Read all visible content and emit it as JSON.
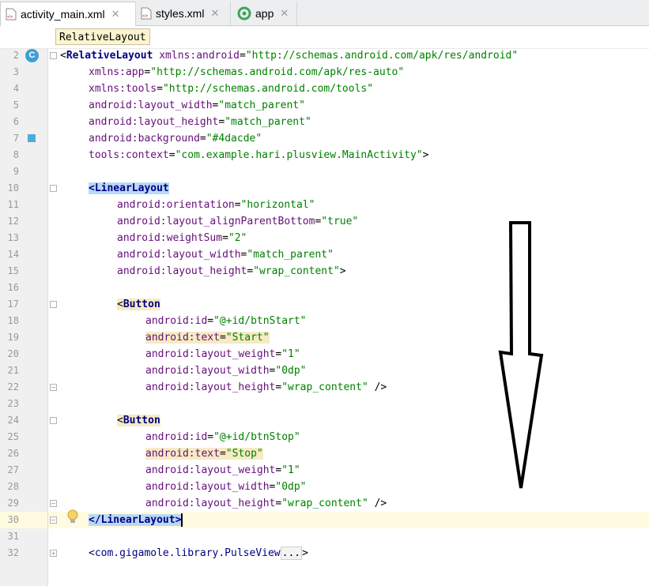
{
  "tabs": [
    {
      "label": "activity_main.xml",
      "icon": "xml-file-icon",
      "active": true
    },
    {
      "label": "styles.xml",
      "icon": "xml-file-icon",
      "active": false
    },
    {
      "label": "app",
      "icon": "android-module-icon",
      "active": false
    }
  ],
  "breadcrumb": "RelativeLayout",
  "line_numbers": [
    "2",
    "3",
    "4",
    "5",
    "6",
    "7",
    "8",
    "9",
    "10",
    "11",
    "12",
    "13",
    "14",
    "15",
    "16",
    "17",
    "18",
    "19",
    "20",
    "21",
    "22",
    "23",
    "24",
    "25",
    "26",
    "27",
    "28",
    "29",
    "30",
    "31",
    "32"
  ],
  "gutter_badge": "C",
  "color_swatch": "#4dacde",
  "code": {
    "l2_open": "<",
    "l2_tag": "RelativeLayout",
    "l2_attr_ns": "xmlns:",
    "l2_attr": "android",
    "l2_eq": "=",
    "l2_val": "\"http://schemas.android.com/apk/res/android\"",
    "l3_ns": "xmlns:",
    "l3_attr": "app",
    "l3_val": "\"http://schemas.android.com/apk/res-auto\"",
    "l4_ns": "xmlns:",
    "l4_attr": "tools",
    "l4_val": "\"http://schemas.android.com/tools\"",
    "l5_ns": "android:",
    "l5_attr": "layout_width",
    "l5_val": "\"match_parent\"",
    "l6_ns": "android:",
    "l6_attr": "layout_height",
    "l6_val": "\"match_parent\"",
    "l7_ns": "android:",
    "l7_attr": "background",
    "l7_val": "\"#4dacde\"",
    "l8_ns": "tools:",
    "l8_attr": "context",
    "l8_val": "\"com.example.hari.plusview.MainActivity\"",
    "l8_close": ">",
    "l10_tag": "<LinearLayout",
    "l11_ns": "android:",
    "l11_attr": "orientation",
    "l11_val": "\"horizontal\"",
    "l12_ns": "android:",
    "l12_attr": "layout_alignParentBottom",
    "l12_val": "\"true\"",
    "l13_ns": "android:",
    "l13_attr": "weightSum",
    "l13_val": "\"2\"",
    "l14_ns": "android:",
    "l14_attr": "layout_width",
    "l14_val": "\"match_parent\"",
    "l15_ns": "android:",
    "l15_attr": "layout_height",
    "l15_val": "\"wrap_content\"",
    "l15_close": ">",
    "l17_lt": "<",
    "l17_tag": "Button",
    "l18_ns": "android:",
    "l18_attr": "id",
    "l18_val": "\"@+id/btnStart\"",
    "l19_ns": "android:",
    "l19_attr": "text",
    "l19_val": "\"Start\"",
    "l20_ns": "android:",
    "l20_attr": "layout_weight",
    "l20_val": "\"1\"",
    "l21_ns": "android:",
    "l21_attr": "layout_width",
    "l21_val": "\"0dp\"",
    "l22_ns": "android:",
    "l22_attr": "layout_height",
    "l22_val": "\"wrap_content\"",
    "l22_close": " />",
    "l24_lt": "<",
    "l24_tag": "Button",
    "l25_ns": "android:",
    "l25_attr": "id",
    "l25_val": "\"@+id/btnStop\"",
    "l26_ns": "android:",
    "l26_attr": "text",
    "l26_val": "\"Stop\"",
    "l27_ns": "android:",
    "l27_attr": "layout_weight",
    "l27_val": "\"1\"",
    "l28_ns": "android:",
    "l28_attr": "layout_width",
    "l28_val": "\"0dp\"",
    "l29_ns": "android:",
    "l29_attr": "layout_height",
    "l29_val": "\"wrap_content\"",
    "l29_close": " />",
    "l30_tag": "</LinearLayout>",
    "l32_tag": "<com.gigamole.library.PulseView",
    "l32_fold": "...",
    "l32_close": ">"
  }
}
